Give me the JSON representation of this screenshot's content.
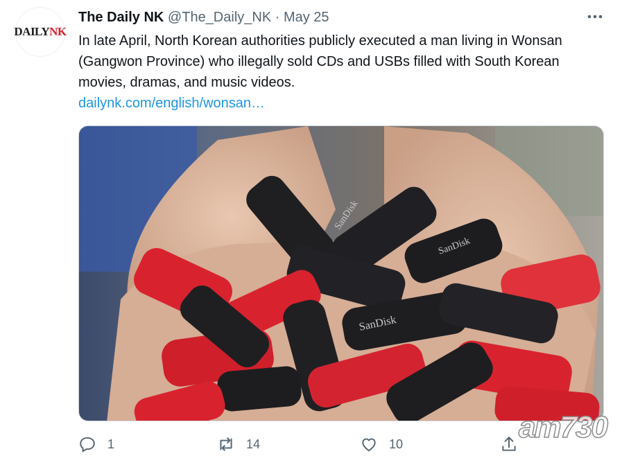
{
  "account": {
    "avatar_text_a": "DAILY",
    "avatar_text_b": "NK",
    "name": "The Daily NK",
    "handle": "@The_Daily_NK",
    "separator": "·",
    "date": "May 25"
  },
  "tweet": {
    "text": "In late April, North Korean authorities publicly executed a man living in Wonsan (Gangwon Province) who illegally sold CDs and USBs filled with South Korean movies, dramas, and music videos.",
    "link": "dailynk.com/english/wonsan…"
  },
  "media": {
    "usb_brand_text": "SanDisk",
    "icon": "usb-drives-photo"
  },
  "actions": {
    "reply_count": "1",
    "retweet_count": "14",
    "like_count": "10"
  },
  "watermark": "am730",
  "colors": {
    "link": "#1b95e0",
    "secondary": "#536471",
    "brand_red": "#d4222b",
    "usb_red": "#d8232f"
  }
}
